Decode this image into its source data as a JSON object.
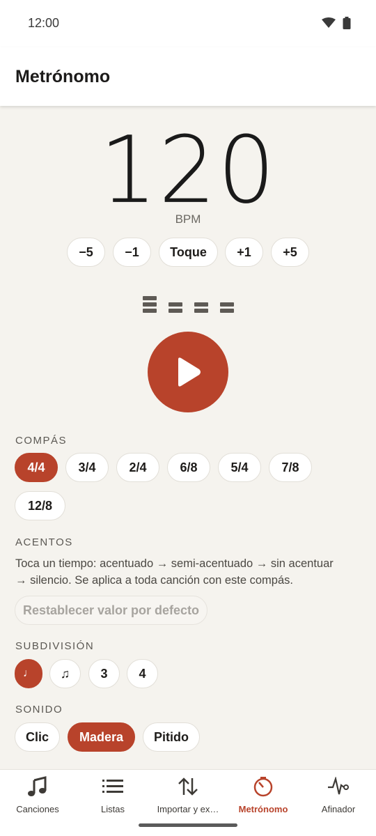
{
  "status": {
    "time": "12:00",
    "wifi_icon": "wifi-icon",
    "battery_icon": "battery-icon"
  },
  "appbar": {
    "title": "Metrónomo"
  },
  "tempo": {
    "value": "120",
    "unit": "BPM"
  },
  "tempo_buttons": [
    {
      "label": "−5"
    },
    {
      "label": "−1"
    },
    {
      "label": "Toque"
    },
    {
      "label": "+1"
    },
    {
      "label": "+5"
    }
  ],
  "beats": [
    {
      "accent": "accented"
    },
    {
      "accent": "semi-accented"
    },
    {
      "accent": "semi-accented"
    },
    {
      "accent": "semi-accented"
    }
  ],
  "play": {
    "icon": "play-icon"
  },
  "time_signature": {
    "label": "COMPÁS",
    "options": [
      "4/4",
      "3/4",
      "2/4",
      "6/8",
      "5/4",
      "7/8",
      "12/8"
    ],
    "selected": "4/4"
  },
  "accents": {
    "label": "ACENTOS",
    "description_line1": "Toca un tiempo: acentuado → semi-acentuado → sin acentuar",
    "description_line2": "→ silencio. Se aplica a toda canción con este compás.",
    "reset_label": "Restablecer valor por defecto"
  },
  "subdivision": {
    "label": "SUBDIVISIÓN",
    "options": [
      "♩",
      "♫",
      "3",
      "4"
    ],
    "selected": "♩"
  },
  "sound": {
    "label": "SONIDO",
    "options": [
      "Clic",
      "Madera",
      "Pitido"
    ],
    "selected": "Madera"
  },
  "nav": {
    "items": [
      {
        "label": "Canciones",
        "icon": "music-note-icon"
      },
      {
        "label": "Listas",
        "icon": "list-icon"
      },
      {
        "label": "Importar y ex…",
        "icon": "import-export-icon"
      },
      {
        "label": "Metrónomo",
        "icon": "metronome-icon"
      },
      {
        "label": "Afinador",
        "icon": "tuner-icon"
      }
    ],
    "active": "Metrónomo"
  },
  "colors": {
    "accent": "#b8432b",
    "background": "#f5f3ee"
  }
}
